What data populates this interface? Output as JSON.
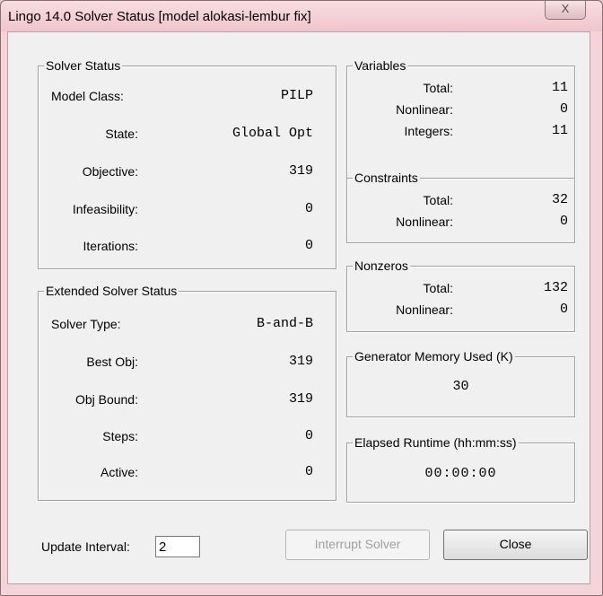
{
  "window": {
    "title": "Lingo 14.0 Solver Status [model alokasi-lembur fix]",
    "close_glyph": "X"
  },
  "solver_status": {
    "title": "Solver Status",
    "model_class_label": "Model Class:",
    "model_class_value": "PILP",
    "state_label": "State:",
    "state_value": "Global Opt",
    "objective_label": "Objective:",
    "objective_value": "319",
    "infeasibility_label": "Infeasibility:",
    "infeasibility_value": "0",
    "iterations_label": "Iterations:",
    "iterations_value": "0"
  },
  "extended_status": {
    "title": "Extended Solver Status",
    "solver_type_label": "Solver Type:",
    "solver_type_value": "B-and-B",
    "best_obj_label": "Best Obj:",
    "best_obj_value": "319",
    "obj_bound_label": "Obj Bound:",
    "obj_bound_value": "319",
    "steps_label": "Steps:",
    "steps_value": "0",
    "active_label": "Active:",
    "active_value": "0"
  },
  "variables": {
    "title": "Variables",
    "total_label": "Total:",
    "total_value": "11",
    "nonlinear_label": "Nonlinear:",
    "nonlinear_value": "0",
    "integers_label": "Integers:",
    "integers_value": "11"
  },
  "constraints": {
    "title": "Constraints",
    "total_label": "Total:",
    "total_value": "32",
    "nonlinear_label": "Nonlinear:",
    "nonlinear_value": "0"
  },
  "nonzeros": {
    "title": "Nonzeros",
    "total_label": "Total:",
    "total_value": "132",
    "nonlinear_label": "Nonlinear:",
    "nonlinear_value": "0"
  },
  "generator_memory": {
    "title": "Generator Memory Used (K)",
    "value": "30"
  },
  "elapsed_runtime": {
    "title": "Elapsed Runtime (hh:mm:ss)",
    "value": "00:00:00"
  },
  "footer": {
    "update_interval_label": "Update Interval:",
    "update_interval_value": "2",
    "interrupt_label": "Interrupt Solver",
    "close_label": "Close"
  }
}
